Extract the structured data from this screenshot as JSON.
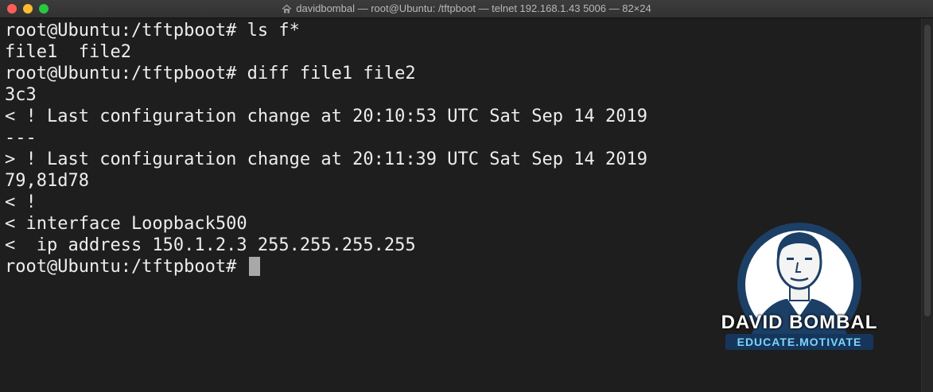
{
  "window": {
    "title": "davidbombal — root@Ubuntu: /tftpboot — telnet 192.168.1.43 5006 — 82×24"
  },
  "terminal": {
    "lines": [
      {
        "prompt": "root@Ubuntu:/tftpboot#",
        "command": " ls f*"
      },
      {
        "text": "file1  file2"
      },
      {
        "prompt": "root@Ubuntu:/tftpboot#",
        "command": " diff file1 file2"
      },
      {
        "text": "3c3"
      },
      {
        "text": "< ! Last configuration change at 20:10:53 UTC Sat Sep 14 2019"
      },
      {
        "text": "---"
      },
      {
        "text": "> ! Last configuration change at 20:11:39 UTC Sat Sep 14 2019"
      },
      {
        "text": "79,81d78"
      },
      {
        "text": "< !"
      },
      {
        "text": "< interface Loopback500"
      },
      {
        "text": "<  ip address 150.1.2.3 255.255.255.255"
      },
      {
        "prompt": "root@Ubuntu:/tftpboot#",
        "command": " "
      }
    ]
  },
  "logo": {
    "name": "DAVID BOMBAL",
    "tagline": "EDUCATE.MOTIVATE"
  },
  "colors": {
    "background": "#1e1e1e",
    "text": "#ededed",
    "cursor": "#a8a8a8",
    "logo_ring": "#1c3f66",
    "logo_tag": "#7fd3ff"
  }
}
